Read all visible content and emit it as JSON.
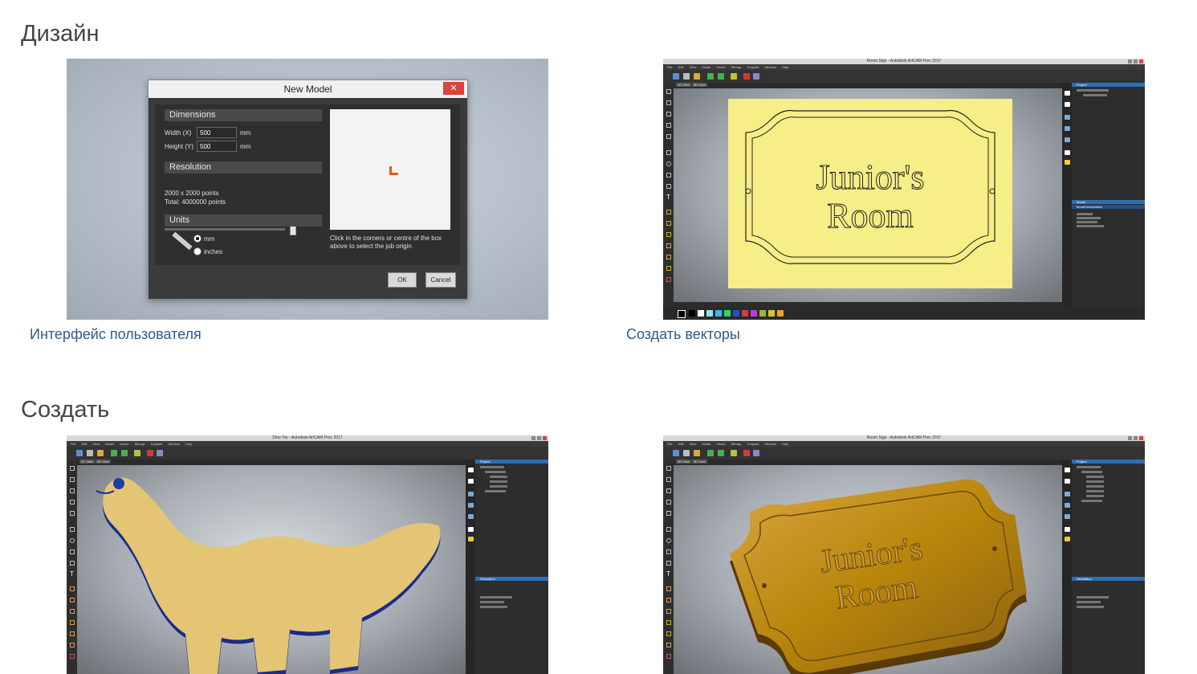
{
  "sections": [
    {
      "title": "Дизайн",
      "items": [
        {
          "caption": "Интерфейс пользователя"
        },
        {
          "caption": "Создать векторы"
        }
      ]
    },
    {
      "title": "Создать"
    }
  ],
  "new_model": {
    "title": "New Model",
    "close": "✕",
    "dimensions_label": "Dimensions",
    "width_label": "Width (X)",
    "width_value": "500",
    "height_label": "Height (Y)",
    "height_value": "500",
    "unit_mm": "mm",
    "resolution_label": "Resolution",
    "resolution_points": "2000 x 2000 points",
    "resolution_total": "Total: 4000000 points",
    "units_label": "Units",
    "option_mm": "mm",
    "option_inches": "inches",
    "origin_hint": "Click in the corners or centre of the box above to select the job origin",
    "ok": "OK",
    "cancel": "Cancel"
  },
  "sign_app": {
    "window_title": "Room Sign - Autodesk ArtCAM Prec 2017",
    "menu": [
      "File",
      "Edit",
      "View",
      "Model",
      "Vector",
      "Bitmap",
      "Toolpath",
      "Window",
      "Help"
    ],
    "tabs": [
      "2D View",
      "3D View"
    ],
    "sign_text_1": "Junior's",
    "sign_text_2": "Room",
    "panel_project": "Project",
    "panel_model": "Model",
    "panel_model_info": "Model Information"
  },
  "dino_app": {
    "window_title": "Dino Toy - Autodesk ArtCAM Prec 2017",
    "panel_project": "Project",
    "panel_simulation": "Simulation"
  },
  "sign3d_app": {
    "window_title": "Room Sign - Autodesk ArtCAM Prec 2017",
    "sign_text_1": "Junior's",
    "sign_text_2": "Room",
    "panel_project": "Project",
    "panel_simulation": "Simulation"
  },
  "colors": {
    "caption_link": "#2f5a8c",
    "sign_bg": "#f6ee86",
    "dino_wood": "#e3c574",
    "dino_edge": "#1c2a8a",
    "wood_3d": "#b8860b",
    "accent": "#2d6fb3"
  }
}
